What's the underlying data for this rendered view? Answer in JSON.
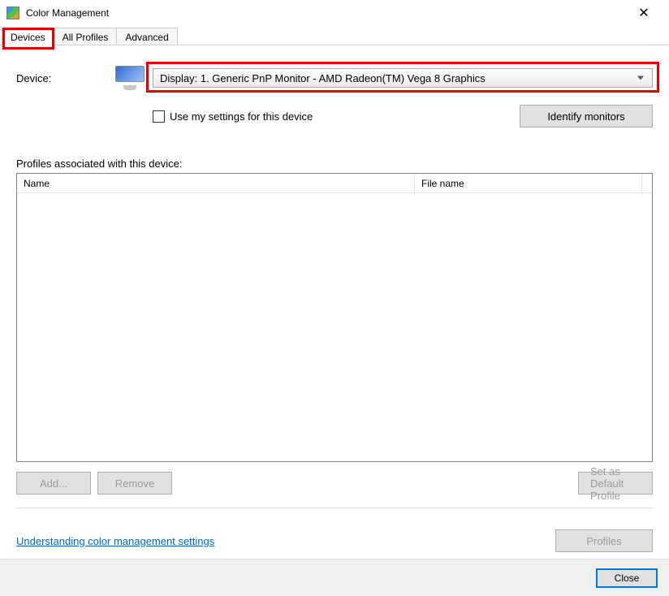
{
  "window": {
    "title": "Color Management"
  },
  "tabs": {
    "items": [
      "Devices",
      "All Profiles",
      "Advanced"
    ],
    "active_index": 0
  },
  "device_section": {
    "label": "Device:",
    "dropdown_value": "Display: 1. Generic PnP Monitor - AMD Radeon(TM) Vega 8 Graphics",
    "use_my_settings_label": "Use my settings for this device",
    "use_my_settings_checked": false,
    "identify_button": "Identify monitors"
  },
  "profiles_section": {
    "label": "Profiles associated with this device:",
    "columns": {
      "name": "Name",
      "file": "File name"
    },
    "rows": []
  },
  "buttons": {
    "add": "Add...",
    "remove": "Remove",
    "set_default": "Set as Default Profile",
    "profiles": "Profiles"
  },
  "link": {
    "understanding": "Understanding color management settings"
  },
  "footer": {
    "close": "Close"
  },
  "highlights": {
    "color": "#e60000"
  }
}
